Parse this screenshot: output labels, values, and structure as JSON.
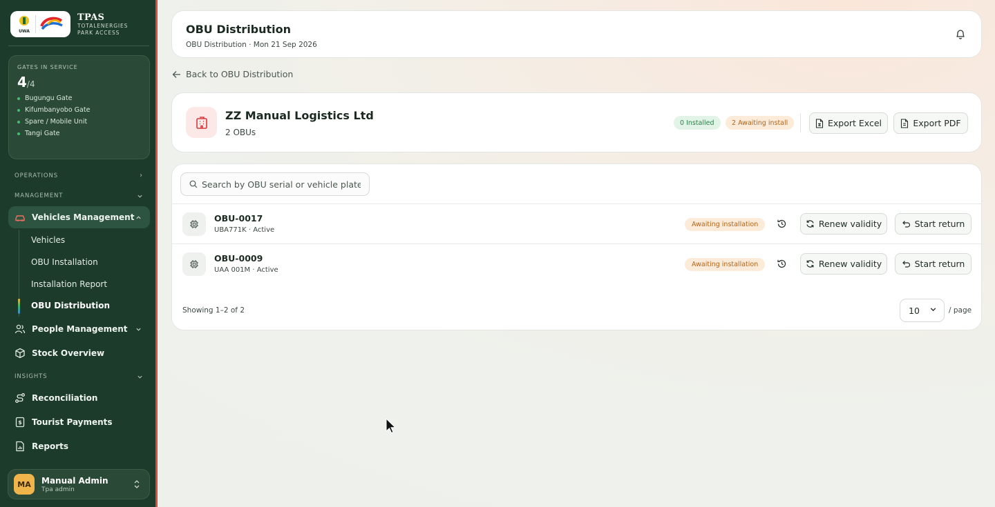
{
  "brand": {
    "title": "TPAS",
    "subtitle_line1": "TOTALENERGIES",
    "subtitle_line2": "PARK ACCESS",
    "logo_left_text": "UWA"
  },
  "gates": {
    "label": "GATES IN SERVICE",
    "count": "4",
    "total": "/4",
    "items": [
      "Bugungu Gate",
      "Kifumbanyobo Gate",
      "Spare / Mobile Unit",
      "Tangi Gate"
    ]
  },
  "sidebar": {
    "operations_label": "OPERATIONS",
    "management_label": "MANAGEMENT",
    "vehicles_management": "Vehicles Management",
    "sub_items": [
      "Vehicles",
      "OBU Installation",
      "Installation Report",
      "OBU Distribution"
    ],
    "people_management": "People Management",
    "stock_overview": "Stock Overview",
    "insights_label": "INSIGHTS",
    "reconciliation": "Reconciliation",
    "tourist_payments": "Tourist Payments",
    "reports": "Reports"
  },
  "user": {
    "initials": "MA",
    "name": "Manual Admin",
    "role": "Tpa admin"
  },
  "header": {
    "title": "OBU Distribution",
    "subtitle": "OBU Distribution · Mon 21 Sep 2026"
  },
  "back_link": "Back to OBU Distribution",
  "company": {
    "name": "ZZ Manual Logistics Ltd",
    "obu_count": "2 OBUs",
    "installed_pill": "0 Installed",
    "awaiting_pill": "2 Awaiting install",
    "export_excel": "Export Excel",
    "export_pdf": "Export PDF"
  },
  "search": {
    "placeholder": "Search by OBU serial or vehicle plate..."
  },
  "rows": [
    {
      "serial": "OBU-0017",
      "meta": "UBA771K · Active",
      "status": "Awaiting installation",
      "renew": "Renew validity",
      "return": "Start return"
    },
    {
      "serial": "OBU-0009",
      "meta": "UAA 001M · Active",
      "status": "Awaiting installation",
      "renew": "Renew validity",
      "return": "Start return"
    }
  ],
  "pagination": {
    "showing": "Showing 1–2 of 2",
    "page_size": "10",
    "per_page": "/ page"
  },
  "colors": {
    "sidebar": "#1d3b2a",
    "accent_red": "#e24a3b",
    "awaiting": "#b2641b",
    "installed": "#2e7e48"
  }
}
